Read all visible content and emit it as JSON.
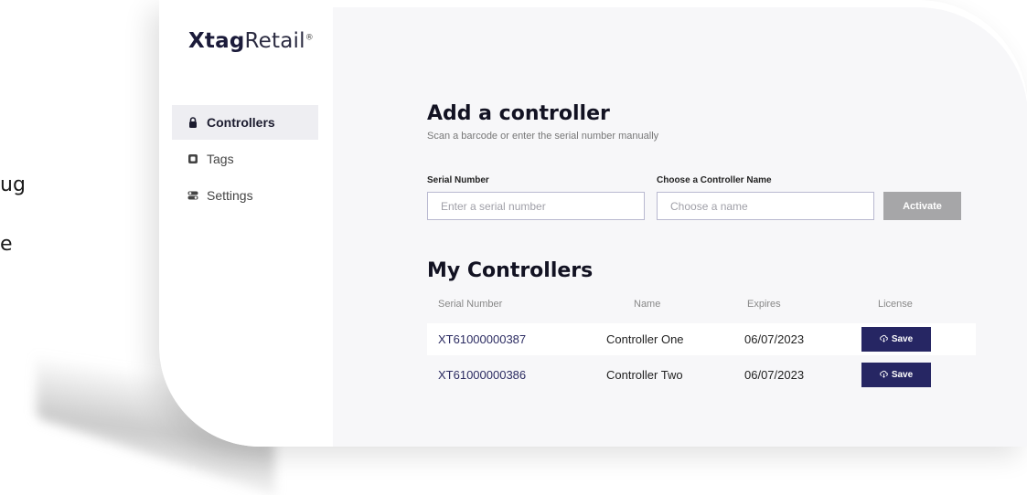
{
  "background_fragments": [
    "ug",
    "e"
  ],
  "app": {
    "logo_bold": "Xtag",
    "logo_light": "Retail",
    "logo_mark": "®"
  },
  "sidebar": {
    "items": [
      {
        "label": "Controllers",
        "icon": "lock-icon",
        "active": true
      },
      {
        "label": "Tags",
        "icon": "tag-square-icon",
        "active": false
      },
      {
        "label": "Settings",
        "icon": "settings-toggle-icon",
        "active": false
      }
    ]
  },
  "add_controller": {
    "title": "Add a controller",
    "subtitle": "Scan a barcode or enter the serial number manually",
    "serial_label": "Serial Number",
    "serial_placeholder": "Enter a serial number",
    "serial_value": "",
    "name_label": "Choose a Controller Name",
    "name_placeholder": "Choose a name",
    "name_value": "",
    "activate_label": "Activate"
  },
  "my_controllers": {
    "title": "My Controllers",
    "columns": [
      "Serial Number",
      "Name",
      "Expires",
      "License"
    ],
    "rows": [
      {
        "serial": "XT61000000387",
        "name": "Controller One",
        "expires": "06/07/2023",
        "license_label": "Save"
      },
      {
        "serial": "XT61000000386",
        "name": "Controller Two",
        "expires": "06/07/2023",
        "license_label": "Save"
      }
    ]
  },
  "colors": {
    "primary": "#262663",
    "activate_disabled": "#a6a6a8",
    "main_background": "#f7f7f9",
    "active_nav": "#eeeef2"
  }
}
